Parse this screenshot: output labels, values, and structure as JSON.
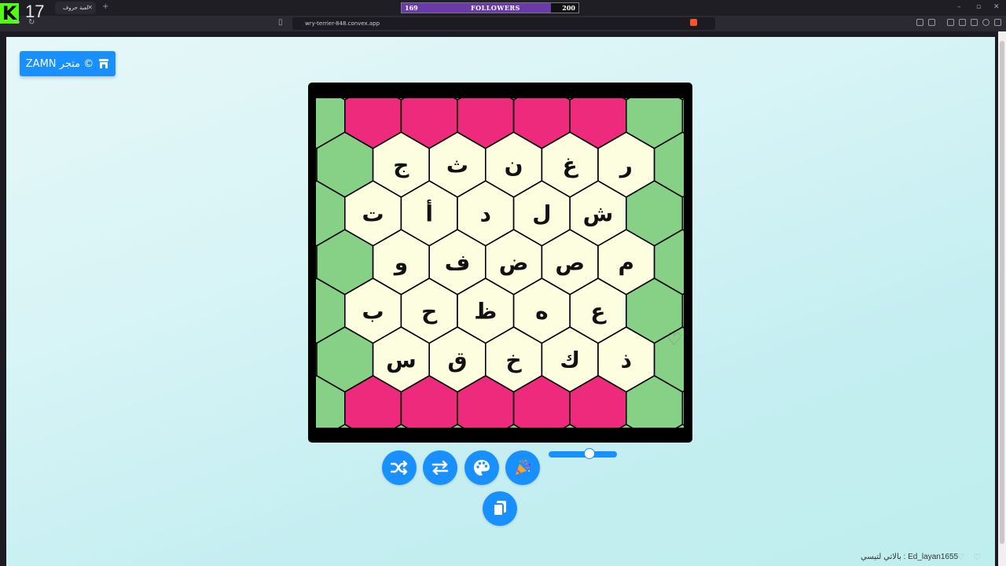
{
  "overlay": {
    "viewer_count": "17",
    "followers_current": "169",
    "followers_label": "FOLLOWERS",
    "followers_goal": "200",
    "followers_progress": 0.845
  },
  "browser": {
    "tab_title": "لعبة حروف",
    "url": "wry-terrier-848.convex.app"
  },
  "page": {
    "store_button_label": "ZAMN متجر ©",
    "footer_text": "بالاتي لتيسي : Ed_layan1655"
  },
  "board": {
    "rows": [
      [
        "ج",
        "ث",
        "ن",
        "غ",
        "ر"
      ],
      [
        "ت",
        "أ",
        "د",
        "ل",
        "ش"
      ],
      [
        "و",
        "ف",
        "ض",
        "ص",
        "م"
      ],
      [
        "ب",
        "ح",
        "ظ",
        "ه",
        "ع"
      ],
      [
        "س",
        "ق",
        "خ",
        "ك",
        "ذ"
      ]
    ],
    "colors": {
      "cell": "#fdfde0",
      "green": "#87d187",
      "pink": "#ed2a7b",
      "frame": "#000000"
    }
  },
  "controls": {
    "buttons": [
      "shuffle-icon",
      "swap-icon",
      "palette-icon",
      "party-icon",
      "copy-icon"
    ],
    "slider_value": 0.6,
    "accent": "#1890ff"
  }
}
